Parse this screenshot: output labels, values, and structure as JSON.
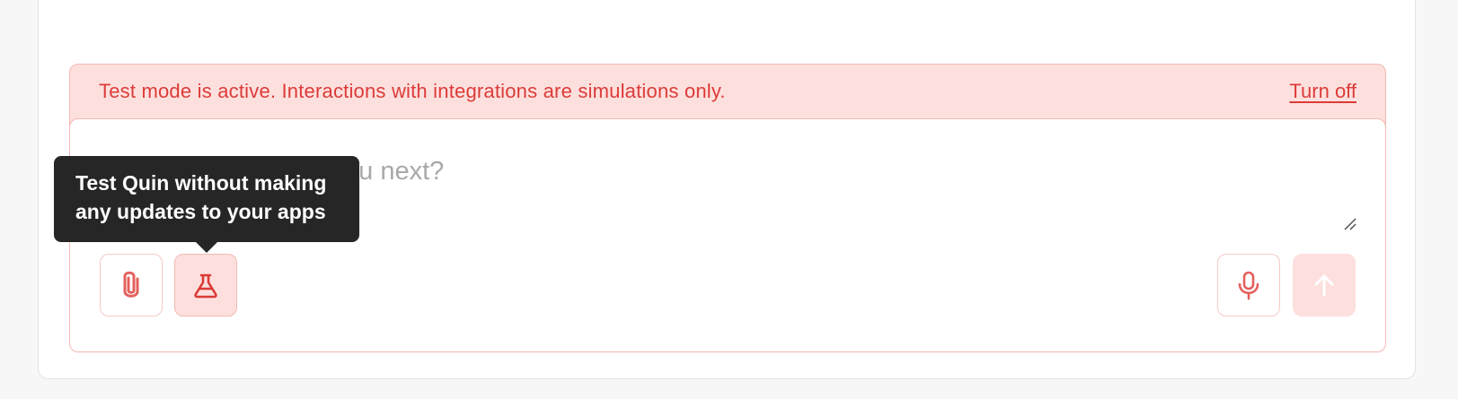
{
  "banner": {
    "message": "Test mode is active. Interactions with integrations are simulations only.",
    "turn_off_label": "Turn off"
  },
  "composer": {
    "placeholder_visible_fragment": "ou next?"
  },
  "tooltip": {
    "line1": "Test Quin without making",
    "line2": "any updates to your apps"
  },
  "icons": {
    "attach": "paperclip-icon",
    "test_mode": "flask-icon",
    "microphone": "microphone-icon",
    "send": "arrow-up-icon",
    "resize": "resize-handle-icon"
  },
  "colors": {
    "accent_red": "#dc3b38",
    "banner_bg": "#fde0de",
    "tooltip_bg": "#262626"
  }
}
